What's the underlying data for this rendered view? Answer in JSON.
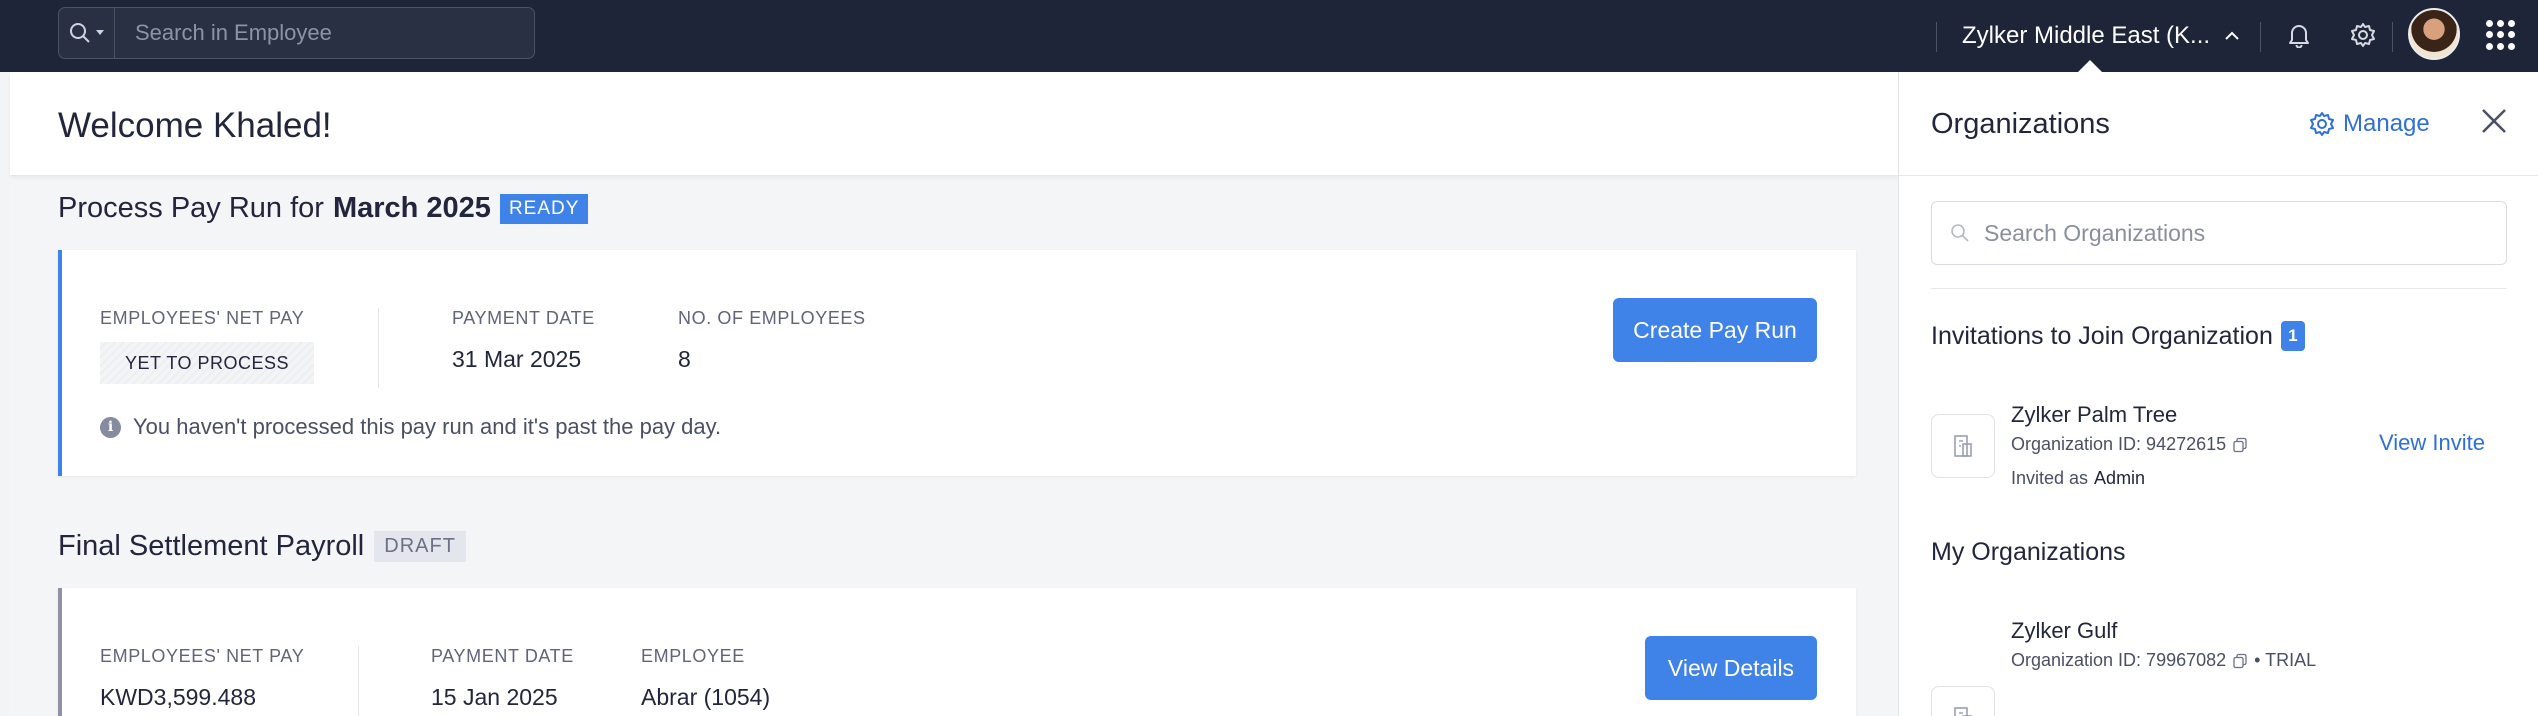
{
  "topbar": {
    "search_placeholder": "Search in Employee",
    "org_name": "Zylker Middle East (K...",
    "icons": [
      "search-icon",
      "chevron-down-icon",
      "bell-icon",
      "gear-icon",
      "apps-grid-icon"
    ]
  },
  "main": {
    "welcome": "Welcome Khaled!",
    "pay_run": {
      "title_prefix": "Process Pay Run for",
      "title_period": "March 2025",
      "status": "READY",
      "net_pay_label": "EMPLOYEES' NET PAY",
      "net_pay_value": "YET TO PROCESS",
      "payment_date_label": "PAYMENT DATE",
      "payment_date_value": "31 Mar 2025",
      "employees_label": "NO. OF EMPLOYEES",
      "employees_value": "8",
      "button": "Create Pay Run",
      "notice": "You haven't processed this pay run and it's past the pay day."
    },
    "final_settlement": {
      "title": "Final Settlement Payroll",
      "status": "DRAFT",
      "net_pay_label": "EMPLOYEES' NET PAY",
      "net_pay_value": "KWD3,599.488",
      "payment_date_label": "PAYMENT DATE",
      "payment_date_value": "15 Jan 2025",
      "employee_label": "EMPLOYEE",
      "employee_value": "Abrar (1054)",
      "button": "View Details"
    }
  },
  "panel": {
    "title": "Organizations",
    "manage": "Manage",
    "search_placeholder": "Search Organizations",
    "invitations_title": "Invitations to Join Organization",
    "invitations_count": "1",
    "invite": {
      "name": "Zylker Palm Tree",
      "id_text": "Organization ID: 94272615",
      "invited_prefix": "Invited as",
      "role": "Admin",
      "action": "View Invite"
    },
    "my_orgs_title": "My Organizations",
    "my_org": {
      "name": "Zylker Gulf",
      "id_text": "Organization ID: 79967082",
      "tag": "• TRIAL"
    }
  },
  "colors": {
    "topbar": "#1f2538",
    "accent": "#3f82e8",
    "link": "#2f6fd6",
    "draft_accent": "#8d93a5"
  }
}
